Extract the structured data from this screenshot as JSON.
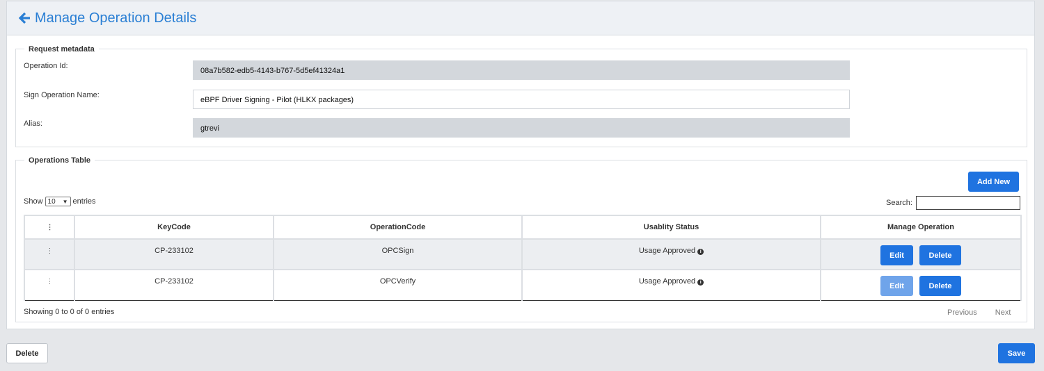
{
  "header": {
    "title": "Manage Operation Details",
    "back_icon": "arrow-left-icon",
    "accent": "#2a7fd4"
  },
  "metadata": {
    "legend": "Request metadata",
    "operation_id_label": "Operation Id:",
    "operation_id_value": "08a7b582-edb5-4143-b767-5d5ef41324a1",
    "sign_name_label": "Sign Operation Name:",
    "sign_name_value": "eBPF Driver Signing - Pilot (HLKX packages)",
    "alias_label": "Alias:",
    "alias_value": "gtrevi"
  },
  "operations": {
    "legend": "Operations Table",
    "add_label": "Add New",
    "show_label": "Show",
    "entries_label": "entries",
    "page_length": "10",
    "search_label": "Search:",
    "search_value": "",
    "columns": [
      "KeyCode",
      "OperationCode",
      "Usablity Status",
      "Manage Operation"
    ],
    "rows": [
      {
        "key": "CP-233102",
        "code": "OPCSign",
        "status": "Usage Approved",
        "edit": "Edit",
        "delete": "Delete",
        "edit_disabled": false
      },
      {
        "key": "CP-233102",
        "code": "OPCVerify",
        "status": "Usage Approved",
        "edit": "Edit",
        "delete": "Delete",
        "edit_disabled": true
      }
    ],
    "info": "Showing 0 to 0 of 0 entries",
    "previous": "Previous",
    "next": "Next"
  },
  "footer": {
    "delete_label": "Delete",
    "save_label": "Save"
  },
  "colors": {
    "primary": "#1f73e0",
    "primary_disabled": "#6fa4ea",
    "readonly_field": "#d3d7dc"
  }
}
